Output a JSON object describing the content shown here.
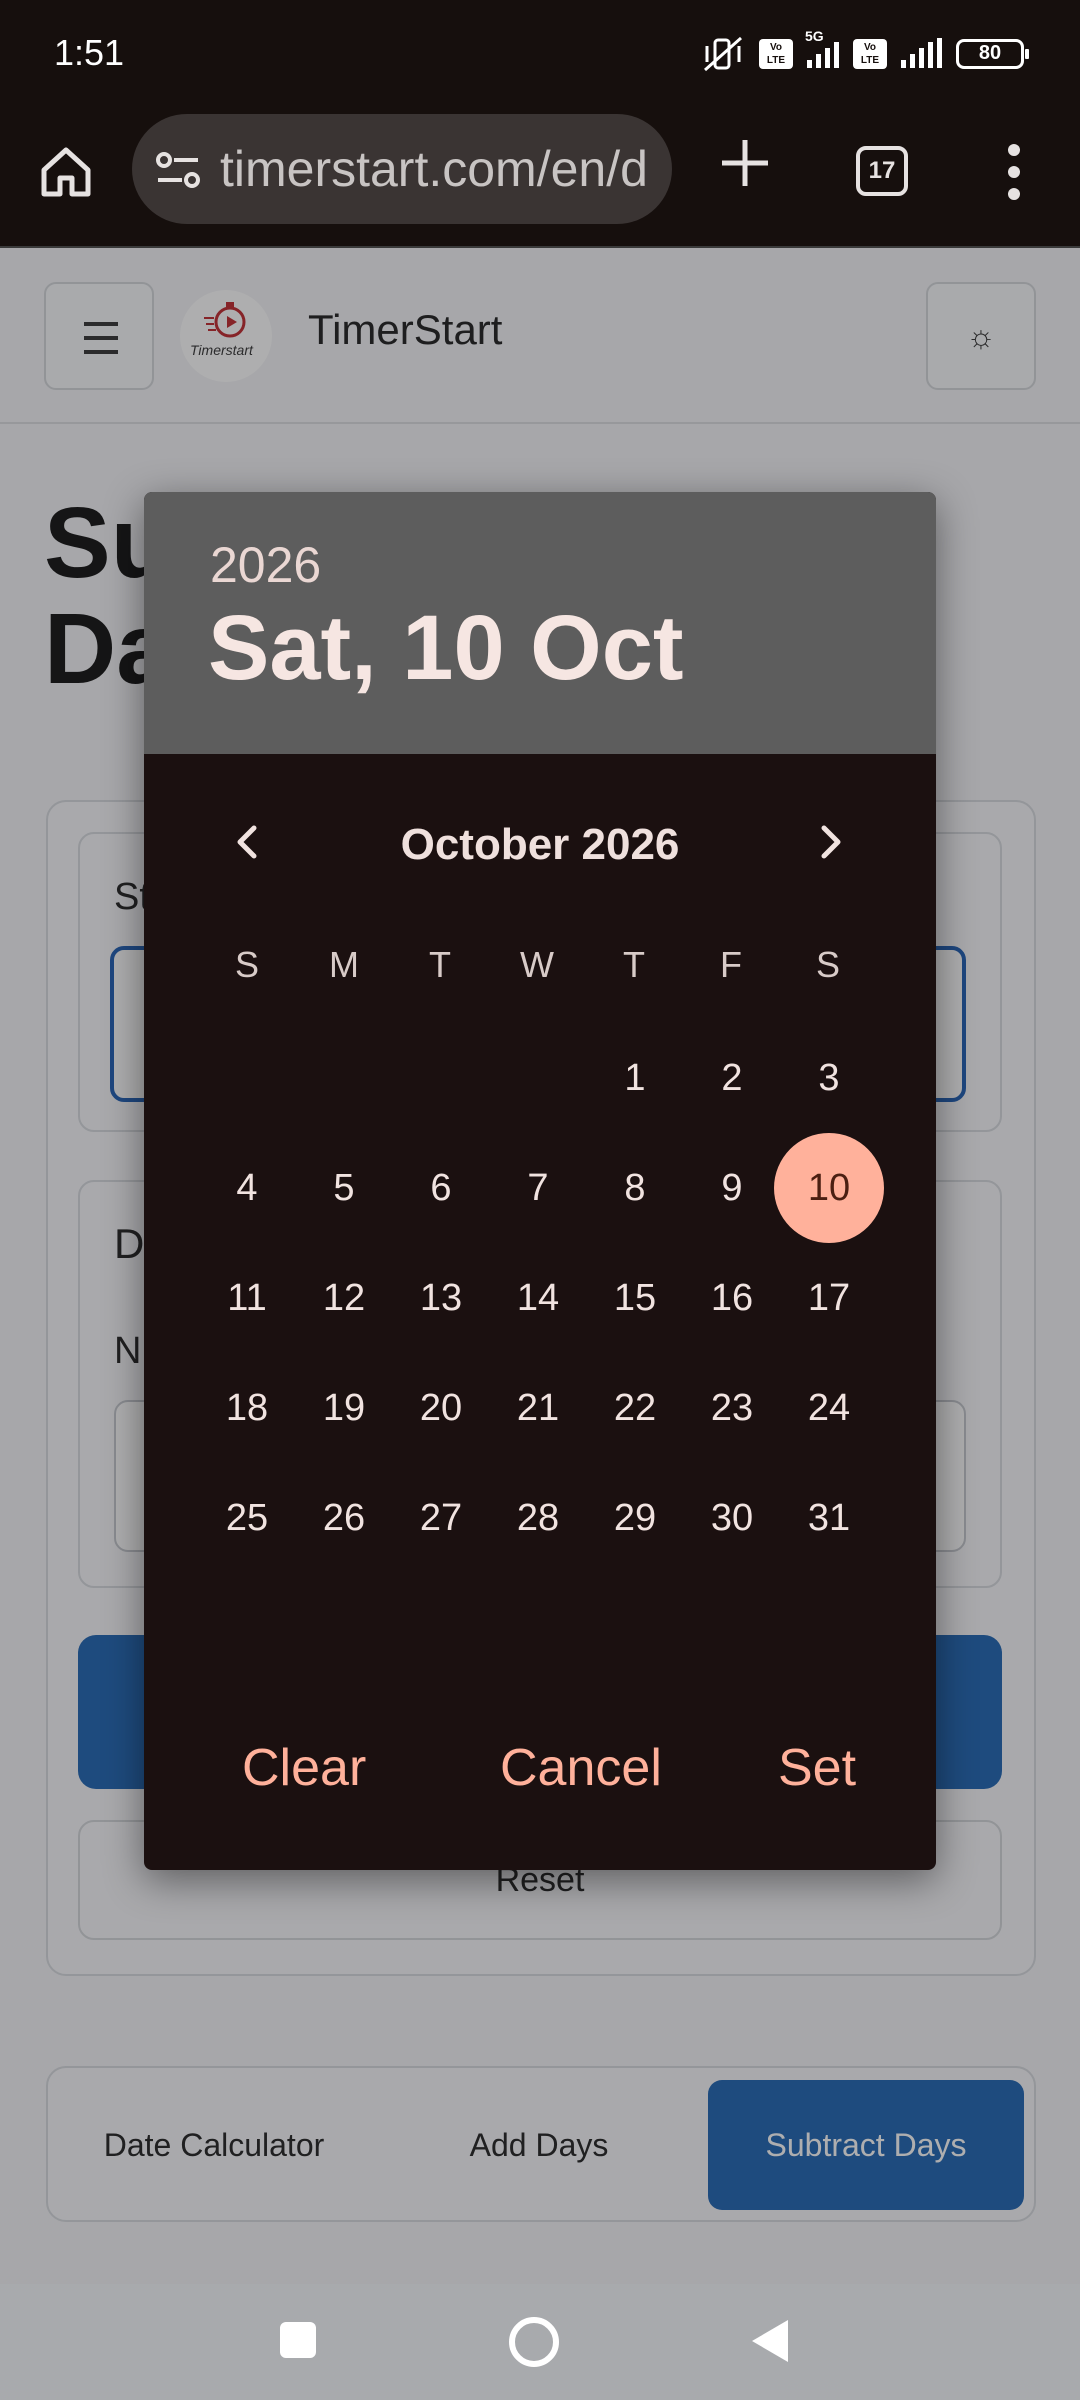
{
  "status_bar": {
    "time": "1:51",
    "battery": "80",
    "network": "5G",
    "volte_label_1": "Vo",
    "volte_label_2": "LTE"
  },
  "browser": {
    "url": "timerstart.com/en/d",
    "tab_count": "17"
  },
  "site_header": {
    "title": "TimerStart",
    "logo_text": "Timerstart",
    "theme_icon": "☼"
  },
  "page": {
    "heading_line1": "Su",
    "heading_line2": "Da",
    "start_label_fragment": "St",
    "days_section_fragment": "D",
    "number_label_fragment": "N",
    "reset_label": "Reset",
    "tabs": [
      {
        "label": "Date Calculator"
      },
      {
        "label": "Add Days"
      },
      {
        "label": "Subtract Days"
      }
    ]
  },
  "date_picker": {
    "year": "2026",
    "selected_date": "Sat, 10 Oct",
    "month_title": "October 2026",
    "weekdays": [
      "S",
      "M",
      "T",
      "W",
      "T",
      "F",
      "S"
    ],
    "days": [
      "1",
      "2",
      "3",
      "4",
      "5",
      "6",
      "7",
      "8",
      "9",
      "10",
      "11",
      "12",
      "13",
      "14",
      "15",
      "16",
      "17",
      "18",
      "19",
      "20",
      "21",
      "22",
      "23",
      "24",
      "25",
      "26",
      "27",
      "28",
      "29",
      "30",
      "31"
    ],
    "selected_day": "10",
    "actions": {
      "clear": "Clear",
      "cancel": "Cancel",
      "set": "Set"
    }
  },
  "colors": {
    "accent": "#ffb19b",
    "primary_blue": "#1f64b3",
    "dialog_bg": "#1b1010",
    "dialog_header": "#5d5d5d"
  },
  "icons": [
    "home-icon",
    "tune-icon",
    "plus-icon",
    "more-vert-icon",
    "hamburger-icon",
    "sun-icon",
    "chevron-left-icon",
    "chevron-right-icon",
    "square-icon",
    "circle-icon",
    "triangle-back-icon"
  ]
}
